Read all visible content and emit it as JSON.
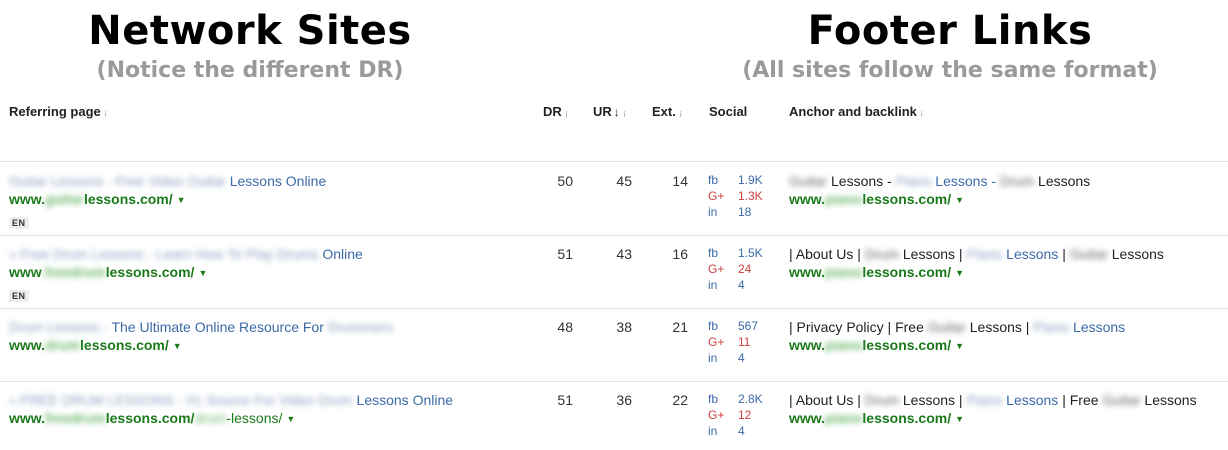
{
  "headlines": {
    "left_title": "Network Sites",
    "left_sub": "(Notice the different DR)",
    "right_title": "Footer Links",
    "right_sub": "(All sites follow the same format)"
  },
  "columns": {
    "referring_page": "Referring page",
    "dr": "DR",
    "ur": "UR",
    "ur_sort": "↓",
    "ext": "Ext.",
    "social": "Social",
    "anchor": "Anchor and backlink",
    "info_glyph": "i"
  },
  "rows": [
    {
      "title_blur": "Guitar Lessons - Free Video Guitar",
      "title_text": "Lessons Online",
      "url_prefix": "www.",
      "url_blur": "guitar",
      "url_suffix": "lessons.com/",
      "url_path_blur": "",
      "url_path": "",
      "lang": "EN",
      "dr": "50",
      "ur": "45",
      "ext": "14",
      "fb_label": "fb",
      "fb": "1.9K",
      "gp_label": "G+",
      "gp": "1.3K",
      "in_label": "in",
      "in": "18",
      "anchor_parts": [
        {
          "t": "Guitar",
          "k": "blur-dark"
        },
        {
          "t": " Lessons - ",
          "k": "plain"
        },
        {
          "t": "Piano",
          "k": "blur"
        },
        {
          "t": " Lessons - ",
          "k": "link"
        },
        {
          "t": "Drum",
          "k": "blur-dark"
        },
        {
          "t": " Lessons",
          "k": "plain"
        }
      ],
      "backlink_prefix": "www.",
      "backlink_blur": "piano",
      "backlink_suffix": "lessons.com/"
    },
    {
      "title_blur": "» Free Drum Lessons - Learn How To Play Drums",
      "title_text": "Online",
      "url_prefix": "www",
      "url_blur": ".freedrum",
      "url_suffix": "lessons.com/",
      "url_path_blur": "",
      "url_path": "",
      "lang": "EN",
      "dr": "51",
      "ur": "43",
      "ext": "16",
      "fb_label": "fb",
      "fb": "1.5K",
      "gp_label": "G+",
      "gp": "24",
      "in_label": "in",
      "in": "4",
      "anchor_parts": [
        {
          "t": "| About Us | ",
          "k": "plain"
        },
        {
          "t": "Drum",
          "k": "blur-dark"
        },
        {
          "t": " Lessons | ",
          "k": "plain"
        },
        {
          "t": "Piano",
          "k": "blur"
        },
        {
          "t": " Lessons",
          "k": "link"
        },
        {
          "t": " | ",
          "k": "plain"
        },
        {
          "t": "Guitar",
          "k": "blur-dark"
        },
        {
          "t": " Lessons",
          "k": "plain"
        }
      ],
      "backlink_prefix": "www.",
      "backlink_blur": "piano",
      "backlink_suffix": "lessons.com/"
    },
    {
      "title_blur": "Drum Lessons -",
      "title_text": "The Ultimate Online Resource For",
      "title_tail_blur": " Drummers",
      "url_prefix": "www.",
      "url_blur": "drum",
      "url_suffix": "lessons.com/",
      "url_path_blur": "",
      "url_path": "",
      "lang": "",
      "dr": "48",
      "ur": "38",
      "ext": "21",
      "fb_label": "fb",
      "fb": "567",
      "gp_label": "G+",
      "gp": "11",
      "in_label": "in",
      "in": "4",
      "anchor_parts": [
        {
          "t": "| Privacy Policy | Free ",
          "k": "plain"
        },
        {
          "t": "Guitar",
          "k": "blur-dark"
        },
        {
          "t": " Lessons | ",
          "k": "plain"
        },
        {
          "t": "Piano",
          "k": "blur"
        },
        {
          "t": " Lessons",
          "k": "link"
        }
      ],
      "backlink_prefix": "www.",
      "backlink_blur": "piano",
      "backlink_suffix": "lessons.com/"
    },
    {
      "title_blur": "» FREE DRUM LESSONS - #1 Source For Video Drum",
      "title_text": "Lessons Online",
      "url_prefix": "www.",
      "url_blur": "freedrum",
      "url_suffix": "lessons.com/",
      "url_path_blur": "drum",
      "url_path": "-lessons/",
      "lang": "",
      "dr": "51",
      "ur": "36",
      "ext": "22",
      "fb_label": "fb",
      "fb": "2.8K",
      "gp_label": "G+",
      "gp": "12",
      "in_label": "in",
      "in": "4",
      "anchor_parts": [
        {
          "t": "| About Us | ",
          "k": "plain"
        },
        {
          "t": "Drum",
          "k": "blur-dark"
        },
        {
          "t": " Lessons | ",
          "k": "plain"
        },
        {
          "t": "Piano",
          "k": "blur"
        },
        {
          "t": " Lessons",
          "k": "link"
        },
        {
          "t": " | Free ",
          "k": "plain"
        },
        {
          "t": "Guitar",
          "k": "blur-dark"
        },
        {
          "t": " Lessons",
          "k": "plain"
        }
      ],
      "backlink_prefix": "www.",
      "backlink_blur": "piano",
      "backlink_suffix": "lessons.com/"
    }
  ]
}
